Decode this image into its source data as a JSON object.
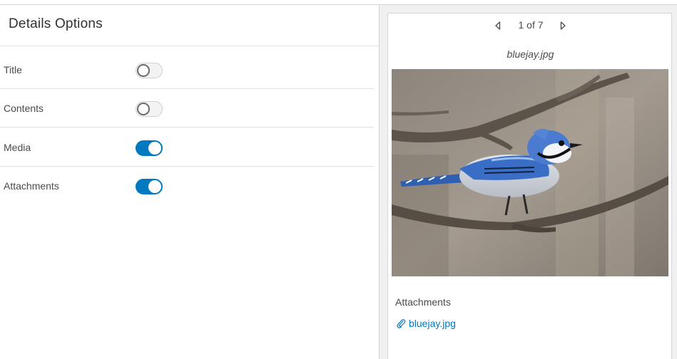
{
  "details_options": {
    "title": "Details Options",
    "options": [
      {
        "label": "Title",
        "enabled": false
      },
      {
        "label": "Contents",
        "enabled": false
      },
      {
        "label": "Media",
        "enabled": true
      },
      {
        "label": "Attachments",
        "enabled": true
      }
    ]
  },
  "preview": {
    "pager": {
      "text": "1 of 7",
      "current": 1,
      "total": 7
    },
    "media_filename": "bluejay.jpg",
    "attachments_heading": "Attachments",
    "attachments": [
      {
        "name": "bluejay.jpg"
      }
    ]
  },
  "colors": {
    "accent": "#0079c1",
    "toggle_off": "#f3f3f3"
  },
  "icons": {
    "prev": "caret-left-icon",
    "next": "caret-right-icon",
    "attachment": "paperclip-icon"
  }
}
